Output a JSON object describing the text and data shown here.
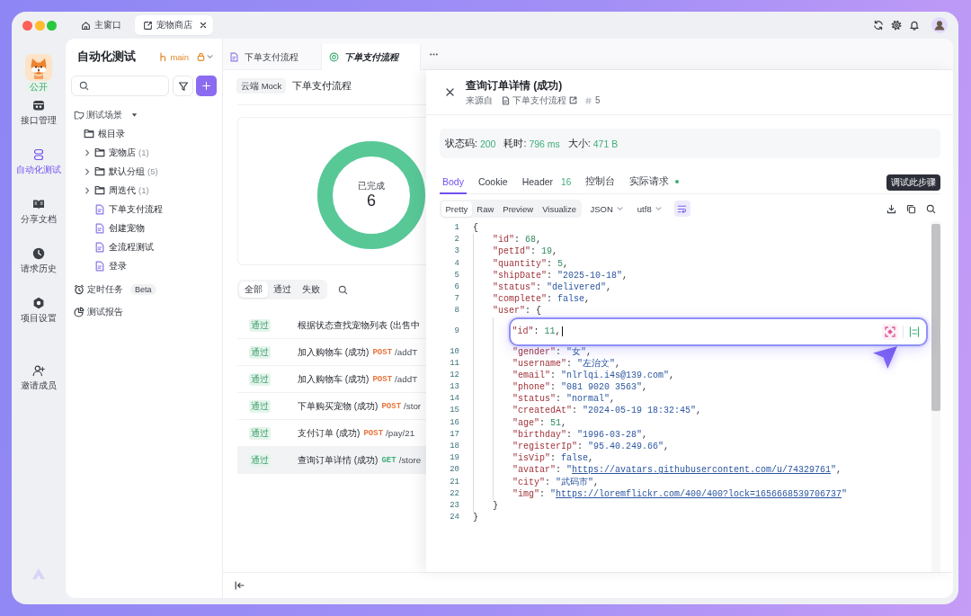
{
  "title_bar": {
    "tabs": [
      {
        "label": "主窗口",
        "kind": "home",
        "selected": false,
        "closable": false
      },
      {
        "label": "宠物商店",
        "kind": "project",
        "selected": true,
        "closable": true
      }
    ]
  },
  "nav_rail": {
    "visibility": "公开",
    "items": [
      {
        "label": "接口管理",
        "kind": "api",
        "selected": false
      },
      {
        "label": "自动化测试",
        "kind": "automation",
        "selected": true
      },
      {
        "label": "分享文档",
        "kind": "docs",
        "selected": false
      },
      {
        "label": "请求历史",
        "kind": "history",
        "selected": false
      },
      {
        "label": "项目设置",
        "kind": "settings",
        "selected": false
      }
    ],
    "extra_items": [
      {
        "label": "邀请成员",
        "kind": "invite",
        "selected": false
      }
    ]
  },
  "sidebar": {
    "title": "自动化测试",
    "branch": "main",
    "tree": {
      "label": "测试场景",
      "expanded": true,
      "children": [
        {
          "label": "根目录",
          "kind": "root",
          "children": [
            {
              "label": "宠物店",
              "count": "(1)",
              "kind": "folder",
              "expanded": false
            },
            {
              "label": "默认分组",
              "count": "(5)",
              "kind": "folder",
              "expanded": false
            },
            {
              "label": "周迭代",
              "count": "(1)",
              "kind": "folder",
              "expanded": false
            },
            {
              "label": "下单支付流程",
              "kind": "file"
            },
            {
              "label": "创建宠物",
              "kind": "file"
            },
            {
              "label": "全流程测试",
              "kind": "file"
            },
            {
              "label": "登录",
              "kind": "file"
            }
          ]
        }
      ]
    },
    "links": [
      {
        "label": "定时任务",
        "kind": "schedule",
        "badge": "Beta"
      },
      {
        "label": "测试报告",
        "kind": "report"
      }
    ]
  },
  "editor_tabs": [
    {
      "label": "下单支付流程",
      "kind": "script",
      "selected": false
    },
    {
      "label": "下单支付流程",
      "kind": "run",
      "selected": true
    }
  ],
  "scenario": {
    "environment": "云端 Mock",
    "title": "下单支付流程",
    "progress": {
      "label": "已完成",
      "count": "6",
      "level": 1
    },
    "filters": [
      {
        "label": "全部",
        "selected": true
      },
      {
        "label": "通过",
        "selected": false
      },
      {
        "label": "失败",
        "selected": false
      }
    ],
    "results": [
      {
        "status": "通过",
        "passed": true,
        "title": "根据状态查找宠物列表 (出售中",
        "selected": false
      },
      {
        "status": "通过",
        "passed": true,
        "title": "加入购物车 (成功)",
        "method": "POST",
        "color": "#e8743b",
        "path": "/addT",
        "selected": false
      },
      {
        "status": "通过",
        "passed": true,
        "title": "加入购物车 (成功)",
        "method": "POST",
        "color": "#e8743b",
        "path": "/addT",
        "selected": false
      },
      {
        "status": "通过",
        "passed": true,
        "title": "下单购买宠物 (成功)",
        "method": "POST",
        "color": "#e8743b",
        "path": "/stor",
        "selected": false
      },
      {
        "status": "通过",
        "passed": true,
        "title": "支付订单 (成功)",
        "method": "POST",
        "color": "#e8743b",
        "path": "/pay/21",
        "selected": false
      },
      {
        "status": "通过",
        "passed": true,
        "title": "查询订单详情 (成功)",
        "method": "GET",
        "color": "#3fae77",
        "path": "/store",
        "selected": true
      }
    ]
  },
  "step_detail": {
    "title": "查询订单详情 (成功)",
    "source_label": "来源自",
    "source": "下单支付流程",
    "step": "5",
    "metrics": [
      {
        "label": "状态码:",
        "value": "200"
      },
      {
        "label": "耗时:",
        "value": "796 ms"
      },
      {
        "label": "大小:",
        "value": "471 B"
      }
    ],
    "tabs": [
      {
        "label": "Body",
        "selected": true,
        "dot": false
      },
      {
        "label": "Cookie",
        "selected": false,
        "dot": false
      },
      {
        "label": "Header",
        "count": "16",
        "selected": false,
        "dot": false
      },
      {
        "label": "控制台",
        "selected": false,
        "dot": false
      },
      {
        "label": "实际请求",
        "selected": false,
        "dot": true
      }
    ],
    "tooltip": "调试此步骤",
    "views": [
      {
        "label": "Pretty",
        "selected": true
      },
      {
        "label": "Raw",
        "selected": false
      },
      {
        "label": "Preview",
        "selected": false
      },
      {
        "label": "Visualize",
        "selected": false
      }
    ],
    "format": "JSON",
    "encoding": "utf8",
    "wrap": {
      "on": true
    },
    "code_lines": [
      {
        "number": "1",
        "selected": false,
        "tokens": [
          {
            "kind": "punct",
            "text": "{"
          }
        ],
        "children": [
          {
            "number": "2",
            "selected": false,
            "tokens": [
              {
                "kind": "key",
                "text": "\"id\""
              },
              {
                "kind": "punct",
                "text": ": "
              },
              {
                "kind": "number",
                "text": "68"
              },
              {
                "kind": "punct",
                "text": ","
              }
            ]
          },
          {
            "number": "3",
            "selected": false,
            "tokens": [
              {
                "kind": "key",
                "text": "\"petId\""
              },
              {
                "kind": "punct",
                "text": ": "
              },
              {
                "kind": "number",
                "text": "19"
              },
              {
                "kind": "punct",
                "text": ","
              }
            ]
          },
          {
            "number": "4",
            "selected": false,
            "tokens": [
              {
                "kind": "key",
                "text": "\"quantity\""
              },
              {
                "kind": "punct",
                "text": ": "
              },
              {
                "kind": "number",
                "text": "5"
              },
              {
                "kind": "punct",
                "text": ","
              }
            ]
          },
          {
            "number": "5",
            "selected": false,
            "tokens": [
              {
                "kind": "key",
                "text": "\"shipDate\""
              },
              {
                "kind": "punct",
                "text": ": "
              },
              {
                "kind": "string",
                "text": "\"2025-10-18\""
              },
              {
                "kind": "punct",
                "text": ","
              }
            ]
          },
          {
            "number": "6",
            "selected": false,
            "tokens": [
              {
                "kind": "key",
                "text": "\"status\""
              },
              {
                "kind": "punct",
                "text": ": "
              },
              {
                "kind": "string",
                "text": "\"delivered\""
              },
              {
                "kind": "punct",
                "text": ","
              }
            ]
          },
          {
            "number": "7",
            "selected": false,
            "tokens": [
              {
                "kind": "key",
                "text": "\"complete\""
              },
              {
                "kind": "punct",
                "text": ": "
              },
              {
                "kind": "boolean",
                "text": "false"
              },
              {
                "kind": "punct",
                "text": ","
              }
            ]
          },
          {
            "number": "8",
            "selected": false,
            "tokens": [
              {
                "kind": "key",
                "text": "\"user\""
              },
              {
                "kind": "punct",
                "text": ": {"
              }
            ],
            "children": [
              {
                "number": "9",
                "selected": true,
                "tokens": [
                  {
                    "kind": "key",
                    "text": "\"id\""
                  },
                  {
                    "kind": "punct",
                    "text": ": "
                  },
                  {
                    "kind": "number",
                    "text": "11"
                  },
                  {
                    "kind": "punct",
                    "text": ","
                  }
                ]
              },
              {
                "number": "10",
                "selected": false,
                "tokens": [
                  {
                    "kind": "key",
                    "text": "\"gender\""
                  },
                  {
                    "kind": "punct",
                    "text": ": "
                  },
                  {
                    "kind": "string",
                    "text": "\"女\""
                  },
                  {
                    "kind": "punct",
                    "text": ","
                  }
                ]
              },
              {
                "number": "11",
                "selected": false,
                "tokens": [
                  {
                    "kind": "key",
                    "text": "\"username\""
                  },
                  {
                    "kind": "punct",
                    "text": ": "
                  },
                  {
                    "kind": "string",
                    "text": "\"左治文\""
                  },
                  {
                    "kind": "punct",
                    "text": ","
                  }
                ]
              },
              {
                "number": "12",
                "selected": false,
                "tokens": [
                  {
                    "kind": "key",
                    "text": "\"email\""
                  },
                  {
                    "kind": "punct",
                    "text": ": "
                  },
                  {
                    "kind": "string",
                    "text": "\"nlrlqi.i4s@139.com\""
                  },
                  {
                    "kind": "punct",
                    "text": ","
                  }
                ]
              },
              {
                "number": "13",
                "selected": false,
                "tokens": [
                  {
                    "kind": "key",
                    "text": "\"phone\""
                  },
                  {
                    "kind": "punct",
                    "text": ": "
                  },
                  {
                    "kind": "string",
                    "text": "\"081 9020 3563\""
                  },
                  {
                    "kind": "punct",
                    "text": ","
                  }
                ]
              },
              {
                "number": "14",
                "selected": false,
                "tokens": [
                  {
                    "kind": "key",
                    "text": "\"status\""
                  },
                  {
                    "kind": "punct",
                    "text": ": "
                  },
                  {
                    "kind": "string",
                    "text": "\"normal\""
                  },
                  {
                    "kind": "punct",
                    "text": ","
                  }
                ]
              },
              {
                "number": "15",
                "selected": false,
                "tokens": [
                  {
                    "kind": "key",
                    "text": "\"createdAt\""
                  },
                  {
                    "kind": "punct",
                    "text": ": "
                  },
                  {
                    "kind": "string",
                    "text": "\"2024-05-19 18:32:45\""
                  },
                  {
                    "kind": "punct",
                    "text": ","
                  }
                ]
              },
              {
                "number": "16",
                "selected": false,
                "tokens": [
                  {
                    "kind": "key",
                    "text": "\"age\""
                  },
                  {
                    "kind": "punct",
                    "text": ": "
                  },
                  {
                    "kind": "number",
                    "text": "51"
                  },
                  {
                    "kind": "punct",
                    "text": ","
                  }
                ]
              },
              {
                "number": "17",
                "selected": false,
                "tokens": [
                  {
                    "kind": "key",
                    "text": "\"birthday\""
                  },
                  {
                    "kind": "punct",
                    "text": ": "
                  },
                  {
                    "kind": "string",
                    "text": "\"1996-03-28\""
                  },
                  {
                    "kind": "punct",
                    "text": ","
                  }
                ]
              },
              {
                "number": "18",
                "selected": false,
                "tokens": [
                  {
                    "kind": "key",
                    "text": "\"registerIp\""
                  },
                  {
                    "kind": "punct",
                    "text": ": "
                  },
                  {
                    "kind": "string",
                    "text": "\"95.40.249.66\""
                  },
                  {
                    "kind": "punct",
                    "text": ","
                  }
                ]
              },
              {
                "number": "19",
                "selected": false,
                "tokens": [
                  {
                    "kind": "key",
                    "text": "\"isVip\""
                  },
                  {
                    "kind": "punct",
                    "text": ": "
                  },
                  {
                    "kind": "boolean",
                    "text": "false"
                  },
                  {
                    "kind": "punct",
                    "text": ","
                  }
                ]
              },
              {
                "number": "20",
                "selected": false,
                "tokens": [
                  {
                    "kind": "key",
                    "text": "\"avatar\""
                  },
                  {
                    "kind": "punct",
                    "text": ": "
                  },
                  {
                    "kind": "string",
                    "text": "\""
                  },
                  {
                    "kind": "link",
                    "text": "https://avatars.githubusercontent.com/u/74329761"
                  },
                  {
                    "kind": "string",
                    "text": "\""
                  },
                  {
                    "kind": "punct",
                    "text": ","
                  }
                ]
              },
              {
                "number": "21",
                "selected": false,
                "tokens": [
                  {
                    "kind": "key",
                    "text": "\"city\""
                  },
                  {
                    "kind": "punct",
                    "text": ": "
                  },
                  {
                    "kind": "string",
                    "text": "\"武码市\""
                  },
                  {
                    "kind": "punct",
                    "text": ","
                  }
                ]
              },
              {
                "number": "22",
                "selected": false,
                "tokens": [
                  {
                    "kind": "key",
                    "text": "\"img\""
                  },
                  {
                    "kind": "punct",
                    "text": ": "
                  },
                  {
                    "kind": "string",
                    "text": "\""
                  },
                  {
                    "kind": "link",
                    "text": "https://loremflickr.com/400/400?lock=1656668539706737"
                  },
                  {
                    "kind": "string",
                    "text": "\""
                  }
                ]
              }
            ]
          },
          {
            "number": "23",
            "selected": false,
            "tokens": [
              {
                "kind": "punct",
                "text": "}"
              }
            ]
          }
        ]
      },
      {
        "number": "24",
        "selected": false,
        "tokens": [
          {
            "kind": "punct",
            "text": "}"
          }
        ]
      }
    ]
  }
}
